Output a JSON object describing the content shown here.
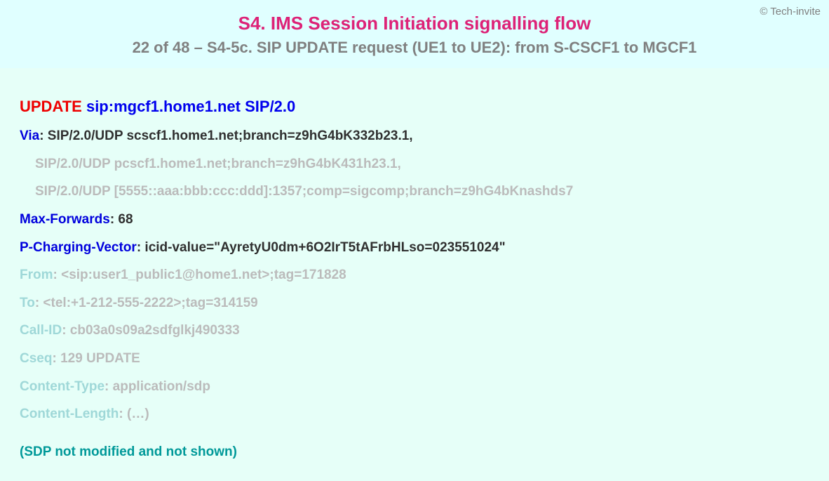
{
  "copyright": "© Tech-invite",
  "title_main": "S4. IMS Session Initiation signalling flow",
  "title_sub": "22 of 48 – S4-5c. SIP UPDATE request (UE1 to UE2): from S-CSCF1 to MGCF1",
  "request": {
    "method": "UPDATE",
    "uri": "sip:mgcf1.home1.net SIP/2.0"
  },
  "via": {
    "name": "Via",
    "first": "SIP/2.0/UDP scscf1.home1.net;branch=z9hG4bK332b23.1,",
    "cont1": "SIP/2.0/UDP pcscf1.home1.net;branch=z9hG4bK431h23.1,",
    "cont2": "SIP/2.0/UDP [5555::aaa:bbb:ccc:ddd]:1357;comp=sigcomp;branch=z9hG4bKnashds7"
  },
  "max_forwards": {
    "name": "Max-Forwards",
    "value": "68"
  },
  "p_charging_vector": {
    "name": "P-Charging-Vector",
    "value": "icid-value=\"AyretyU0dm+6O2IrT5tAFrbHLso=023551024\""
  },
  "from": {
    "name": "From",
    "value": "<sip:user1_public1@home1.net>;tag=171828"
  },
  "to": {
    "name": "To",
    "value": "<tel:+1-212-555-2222>;tag=314159"
  },
  "call_id": {
    "name": "Call-ID",
    "value": "cb03a0s09a2sdfglkj490333"
  },
  "cseq": {
    "name": "Cseq",
    "value": "129 UPDATE"
  },
  "content_type": {
    "name": "Content-Type",
    "value": "application/sdp"
  },
  "content_length": {
    "name": "Content-Length",
    "value": "(…)"
  },
  "sdp_note": "(SDP not modified and not shown)"
}
